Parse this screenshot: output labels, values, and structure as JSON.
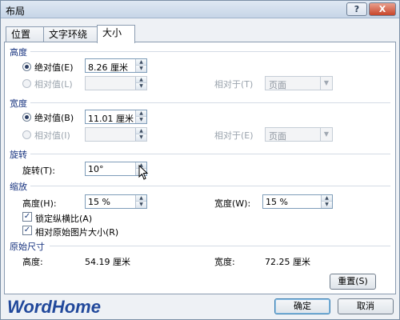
{
  "window": {
    "title": "布局",
    "help": "?",
    "close": "X"
  },
  "tabs": [
    {
      "label": "位置"
    },
    {
      "label": "文字环绕"
    },
    {
      "label": "大小"
    }
  ],
  "height": {
    "section": "高度",
    "absolute_label": "绝对值(E)",
    "absolute_value": "8.26 厘米",
    "relative_label": "相对值(L)",
    "relative_to_label": "相对于(T)",
    "relative_to_value": "页面"
  },
  "width": {
    "section": "宽度",
    "absolute_label": "绝对值(B)",
    "absolute_value": "11.01 厘米",
    "relative_label": "相对值(I)",
    "relative_to_label": "相对于(E)",
    "relative_to_value": "页面"
  },
  "rotation": {
    "section": "旋转",
    "label": "旋转(T):",
    "value": "10°"
  },
  "scale": {
    "section": "缩放",
    "height_label": "高度(H):",
    "height_value": "15 %",
    "width_label": "宽度(W):",
    "width_value": "15 %",
    "lock_aspect_label": "锁定纵横比(A)",
    "relative_original_label": "相对原始图片大小(R)"
  },
  "original_size": {
    "section": "原始尺寸",
    "height_label": "高度:",
    "height_value": "54.19 厘米",
    "width_label": "宽度:",
    "width_value": "72.25 厘米"
  },
  "buttons": {
    "reset": "重置(S)",
    "ok": "确定",
    "cancel": "取消"
  },
  "watermark": "WordHome"
}
